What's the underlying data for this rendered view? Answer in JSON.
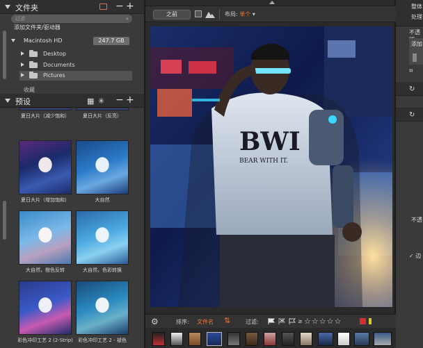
{
  "folders_panel": {
    "title": "文件夹",
    "search_placeholder": "过滤",
    "add_label": "添加文件夹/驱动器",
    "drive_name": "Macintosh HD",
    "drive_size": "247.7 GB",
    "folders": [
      "Desktop",
      "Documents",
      "Pictures"
    ],
    "recipe_label": "收藏"
  },
  "presets_panel": {
    "title": "预设",
    "top_labels": [
      "夏日大片（减少饱和）",
      "夏日大片（反亮）"
    ],
    "items": [
      {
        "label": "夏日大片（增加饱和）"
      },
      {
        "label": "大自然"
      },
      {
        "label": "大自然，橙色反转"
      },
      {
        "label": "大自然，色彩转换"
      },
      {
        "label": "彩色冲印工艺 2 (2-Strip)"
      },
      {
        "label": "彩色冲印工艺 2 - 褪色"
      }
    ]
  },
  "viewer": {
    "before_label": "之前",
    "layout_label": "布局:",
    "layout_value": "单个"
  },
  "toolbar": {
    "sort_label": "排序:",
    "sort_value": "文件名",
    "filter_label": "过滤:",
    "rating_prefix": "≥",
    "stars": "☆☆☆☆☆"
  },
  "right_panel": {
    "lines": [
      "整体",
      "处理",
      "不透明",
      "添加",
      "不透"
    ],
    "checkbox_label": "✓ 边"
  },
  "colors": {
    "accent": "#e8783c",
    "panel_bg": "#3a3a3a",
    "header_bg": "#2f2f2f"
  }
}
